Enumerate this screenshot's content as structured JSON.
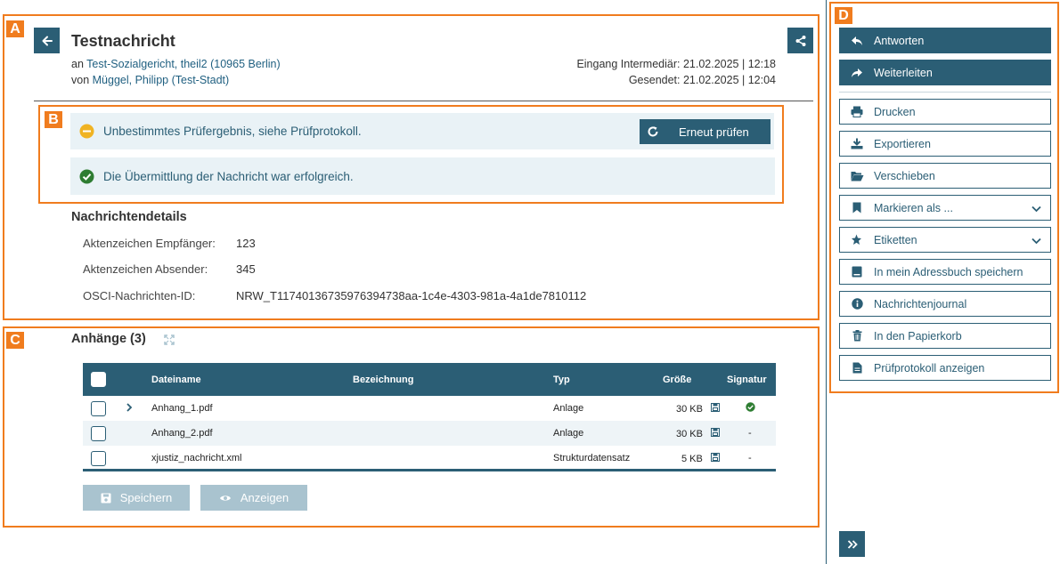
{
  "markers": {
    "a": "A",
    "b": "B",
    "c": "C",
    "d": "D"
  },
  "message": {
    "title": "Testnachricht",
    "to_prefix": "an",
    "to_link": "Test-Sozialgericht, theil2 (10965 Berlin)",
    "from_prefix": "von",
    "from_link": "Müggel, Philipp (Test-Stadt)",
    "received": "Eingang Intermediär: 21.02.2025 | 12:18",
    "sent": "Gesendet: 21.02.2025 | 12:04"
  },
  "notices": {
    "warning_text": "Unbestimmtes Prüfergebnis, siehe Prüfprotokoll.",
    "recheck_label": "Erneut prüfen",
    "success_text": "Die Übermittlung der Nachricht war erfolgreich."
  },
  "details": {
    "heading": "Nachrichtendetails",
    "rows": [
      {
        "label": "Aktenzeichen Empfänger:",
        "value": "123"
      },
      {
        "label": "Aktenzeichen Absender:",
        "value": "345"
      },
      {
        "label": "OSCI-Nachrichten-ID:",
        "value": "NRW_T11740136735976394738aa-1c4e-4303-981a-4a1de7810112"
      }
    ]
  },
  "attachments": {
    "heading": "Anhänge (3)",
    "columns": {
      "filename": "Dateiname",
      "designation": "Bezeichnung",
      "type": "Typ",
      "size": "Größe",
      "signature": "Signatur"
    },
    "rows": [
      {
        "filename": "Anhang_1.pdf",
        "type": "Anlage",
        "size": "30 KB",
        "signature": "ok"
      },
      {
        "filename": "Anhang_2.pdf",
        "type": "Anlage",
        "size": "30 KB",
        "signature": "-"
      },
      {
        "filename": "xjustiz_nachricht.xml",
        "type": "Strukturdatensatz",
        "size": "5 KB",
        "signature": "-"
      }
    ],
    "save_label": "Speichern",
    "view_label": "Anzeigen"
  },
  "sidebar": {
    "reply": "Antworten",
    "forward": "Weiterleiten",
    "print": "Drucken",
    "export": "Exportieren",
    "move": "Verschieben",
    "mark_as": "Markieren als ...",
    "labels": "Etiketten",
    "address_book": "In mein Adressbuch speichern",
    "journal": "Nachrichtenjournal",
    "trash": "In den Papierkorb",
    "protocol": "Prüfprotokoll anzeigen"
  },
  "colors": {
    "accent": "#2b5e75",
    "highlight": "#f07c1e",
    "notice_bg": "#e9f2f6",
    "warning": "#f0b323",
    "success": "#2e7d32"
  }
}
